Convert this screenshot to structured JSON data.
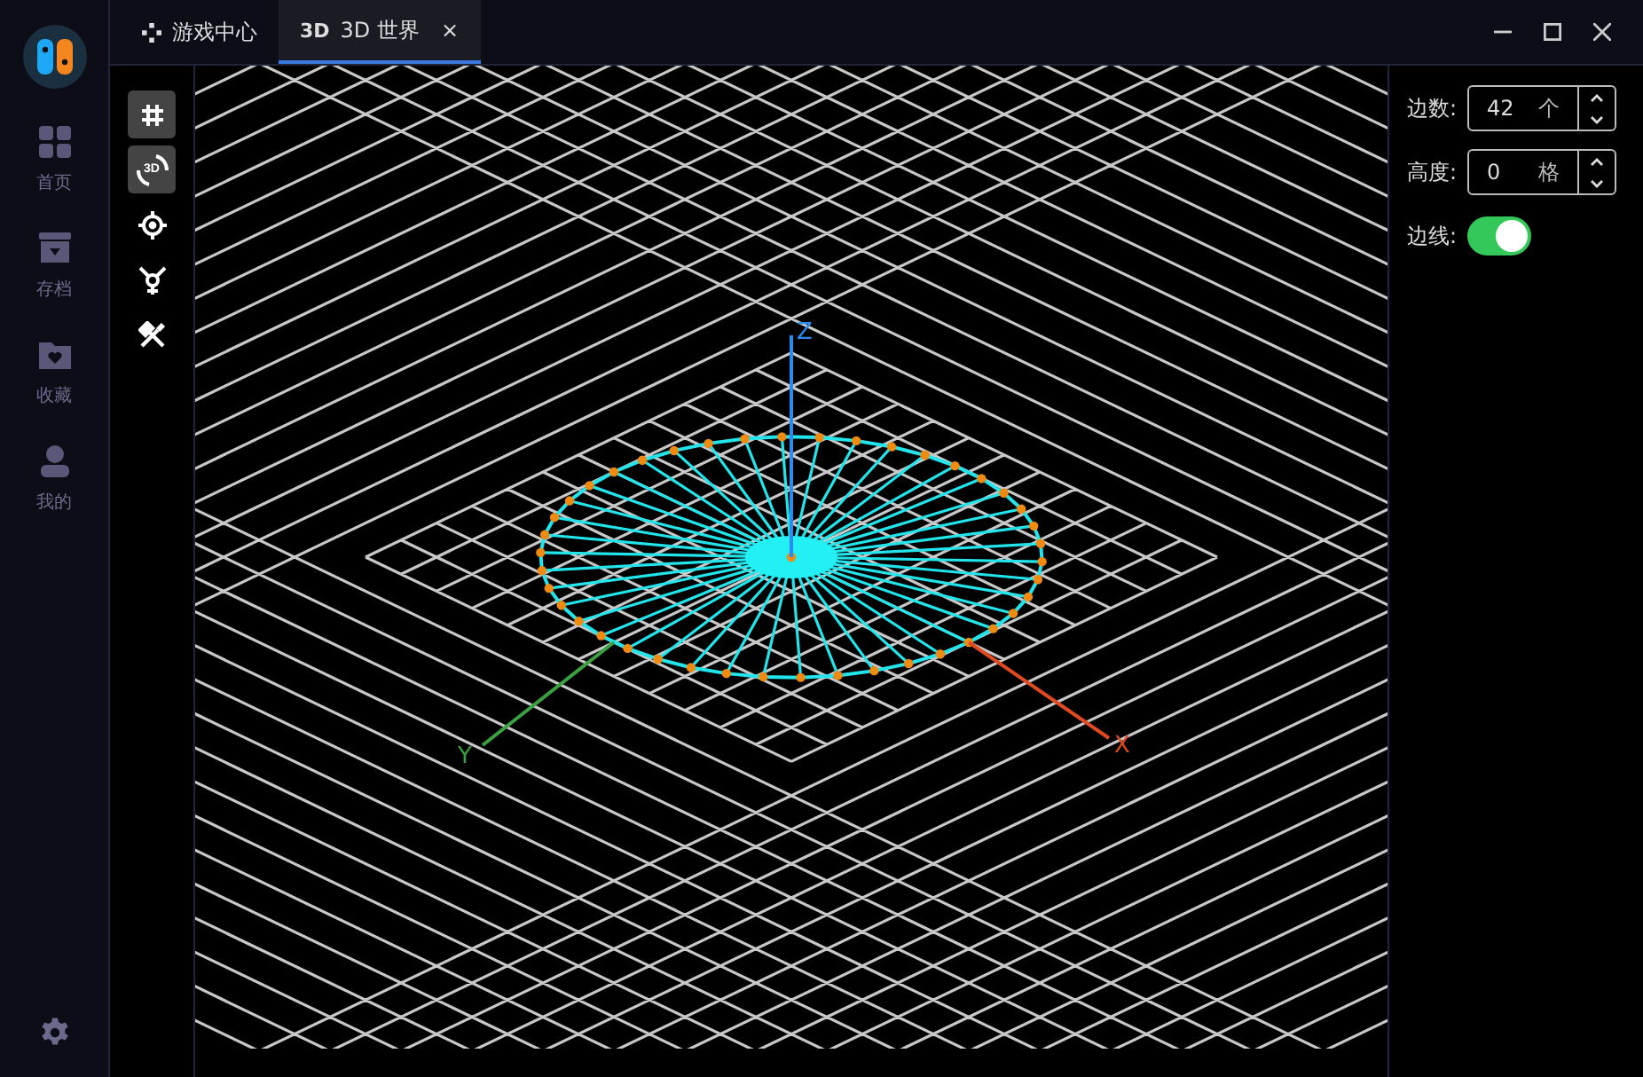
{
  "sidebar": {
    "items": [
      {
        "label": "首页"
      },
      {
        "label": "存档"
      },
      {
        "label": "收藏"
      },
      {
        "label": "我的"
      }
    ]
  },
  "tabs": [
    {
      "label": "游戏中心",
      "selected": false
    },
    {
      "icon_text": "3D",
      "label": "3D 世界",
      "selected": true,
      "close": "×"
    }
  ],
  "toolbar": [
    {
      "selected": true
    },
    {
      "text": "3D",
      "selected": true
    },
    {
      "selected": false
    },
    {
      "selected": false
    },
    {
      "selected": false
    }
  ],
  "scene": {
    "axes": {
      "x": "X",
      "y": "Y",
      "z": "Z"
    }
  },
  "controls": [
    {
      "kind": "number",
      "label": "边数:",
      "value": "42",
      "unit": "个"
    },
    {
      "kind": "number",
      "label": "高度:",
      "value": "0",
      "unit": "格"
    },
    {
      "kind": "switch",
      "label": "边线:",
      "on": true
    }
  ]
}
